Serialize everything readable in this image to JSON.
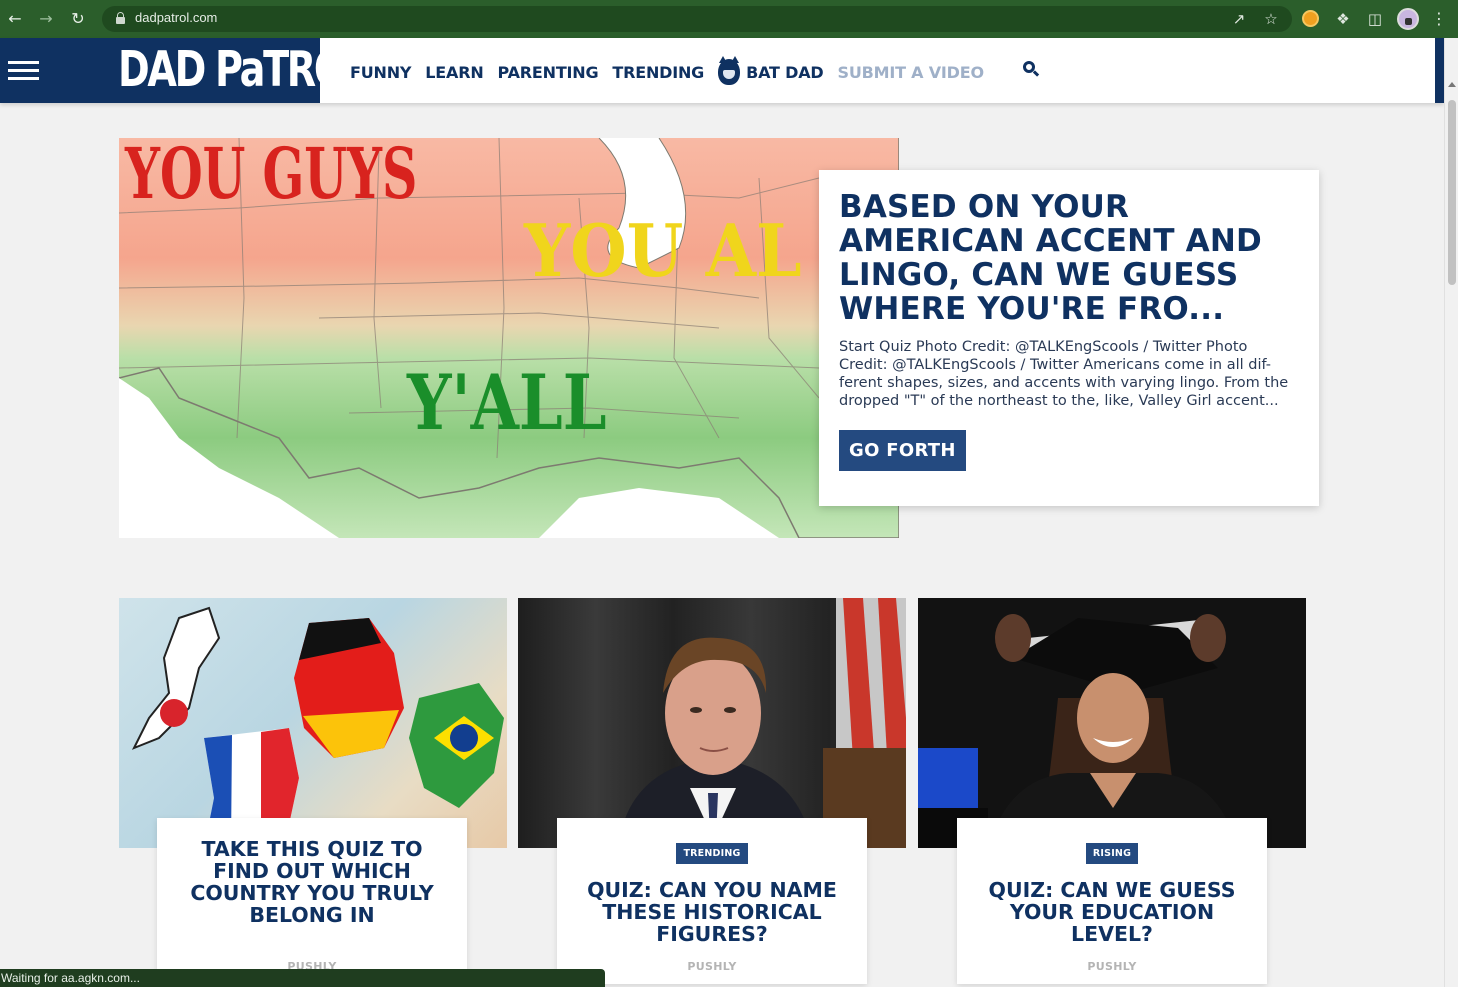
{
  "browser": {
    "url": "dadpatrol.com",
    "status_text": "Waiting for aa.agkn.com..."
  },
  "site": {
    "logo": "DAD PaTROL",
    "nav": [
      {
        "label": "FUNNY"
      },
      {
        "label": "LEARN"
      },
      {
        "label": "PARENTING"
      },
      {
        "label": "TRENDING"
      },
      {
        "label": "BAT DAD"
      },
      {
        "label": "SUBMIT A VIDEO"
      }
    ]
  },
  "hero": {
    "image_words": [
      "YOU GUYS",
      "YOU AL",
      "Y'ALL"
    ],
    "title": "BASED ON YOUR AMERICAN ACCENT AND LINGO, CAN WE GUESS WHERE YOU'RE FRO...",
    "excerpt": "Start Quiz Photo Credit: @TALKEngScools / Twitter Photo Credit: @TALKEngScools / Twitter Americans come in all dif-ferent shapes, sizes, and accents with varying lingo. From the dropped \"T\" of the northeast to the, like, Valley Girl accent...",
    "button": "GO FORTH"
  },
  "cards": [
    {
      "badge": "",
      "title": "TAKE THIS QUIZ TO FIND OUT WHICH COUNTRY YOU TRULY BELONG IN",
      "source": "PUSHLY"
    },
    {
      "badge": "TRENDING",
      "title": "QUIZ: CAN YOU NAME THESE HISTORICAL FIGURES?",
      "source": "PUSHLY"
    },
    {
      "badge": "RISING",
      "title": "QUIZ: CAN WE GUESS YOUR EDUCATION LEVEL?",
      "source": "PUSHLY"
    }
  ],
  "colors": {
    "navy": "#0f3161",
    "button_blue": "#244a80",
    "chrome_green": "#2b5e2b",
    "muted_nav": "#9fb0c8"
  },
  "icons": [
    "back-arrow-icon",
    "forward-arrow-icon",
    "reload-icon",
    "lock-icon",
    "share-icon",
    "star-icon",
    "extension-icon",
    "puzzle-icon",
    "sidepanel-icon",
    "profile-icon",
    "kebab-menu-icon",
    "hamburger-icon",
    "bat-dad-icon",
    "search-icon"
  ]
}
